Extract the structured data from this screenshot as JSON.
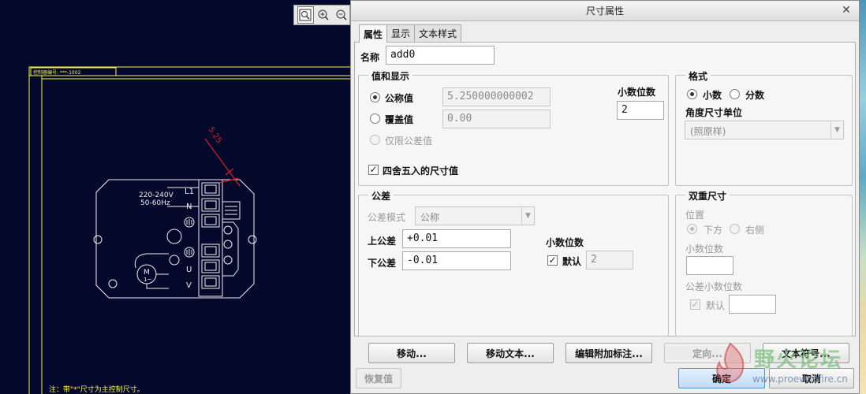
{
  "cad": {
    "header_label": "控制器编号: ***-1002",
    "dimension_text": "5.25",
    "label_voltage": "220-240V",
    "label_freq": "50-60Hz",
    "terminal_labels": [
      "L1",
      "N",
      "U",
      "V"
    ],
    "motor_label": "M",
    "motor_sub": "1~",
    "footnote": "注：带\"*\"尺寸为主控制尺寸。",
    "colors": {
      "background": "#04082a",
      "lines": "#f0f0f0",
      "frame": "#f4f44a",
      "dimension": "#d61f2a"
    }
  },
  "zoom_toolbar": {
    "icons": [
      "zoom-refit-icon",
      "zoom-in-icon",
      "zoom-out-icon"
    ]
  },
  "dialog": {
    "title": "尺寸属性",
    "close_glyph": "✕",
    "tabs": [
      "属性",
      "显示",
      "文本样式"
    ],
    "name_label": "名称",
    "name_value": "add0",
    "value_display": {
      "title": "值和显示",
      "nominal_label": "公称值",
      "nominal_value": "5.250000000002",
      "override_label": "覆盖值",
      "override_value": "0.00",
      "tolerance_only_label": "仅限公差值",
      "decimals_label": "小数位数",
      "decimals_value": "2",
      "round_label": "四舍五入的尺寸值"
    },
    "format": {
      "title": "格式",
      "decimal_label": "小数",
      "fraction_label": "分数",
      "angle_units_label": "角度尺寸单位",
      "angle_units_value": "(照原样)"
    },
    "tolerance": {
      "title": "公差",
      "mode_label": "公差模式",
      "mode_value": "公称",
      "upper_label": "上公差",
      "upper_value": "+0.01",
      "lower_label": "下公差",
      "lower_value": "-0.01",
      "decimals_label": "小数位数",
      "default_label": "默认",
      "decimals_value": "2"
    },
    "dual": {
      "title": "双重尺寸",
      "position_label": "位置",
      "below_label": "下方",
      "right_label": "右侧",
      "decimals_label": "小数位数",
      "tol_decimals_label": "公差小数位数",
      "default_label": "默认"
    },
    "buttons": {
      "move": "移动...",
      "move_text": "移动文本...",
      "edit_attached": "编辑附加标注...",
      "orient": "定向...",
      "text_symbol": "文本符号...",
      "restore": "恢复值",
      "ok": "确定",
      "cancel": "取消"
    }
  },
  "watermark": {
    "title": "野火论坛",
    "url": "www.proewildfire.cn"
  }
}
